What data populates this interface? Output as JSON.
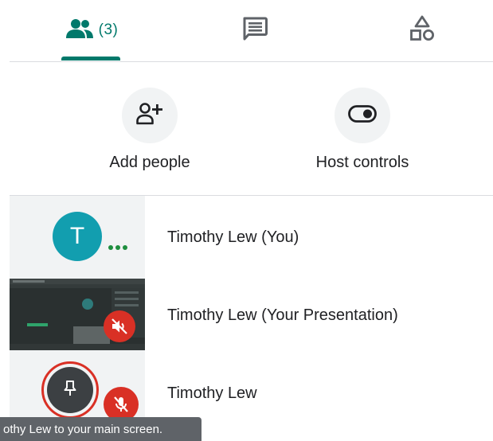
{
  "tabs": {
    "people_count": "(3)",
    "active_color": "#00796b",
    "icons": [
      "people-icon",
      "chat-icon",
      "activities-icon"
    ]
  },
  "actions": {
    "add_people_label": "Add people",
    "host_controls_label": "Host controls"
  },
  "participants": [
    {
      "name": "Timothy Lew (You)",
      "avatar_letter": "T",
      "avatar_color": "#129eaf"
    },
    {
      "name": "Timothy Lew (Your Presentation)"
    },
    {
      "name": "Timothy Lew"
    }
  ],
  "tooltip": "othy Lew to your main screen."
}
